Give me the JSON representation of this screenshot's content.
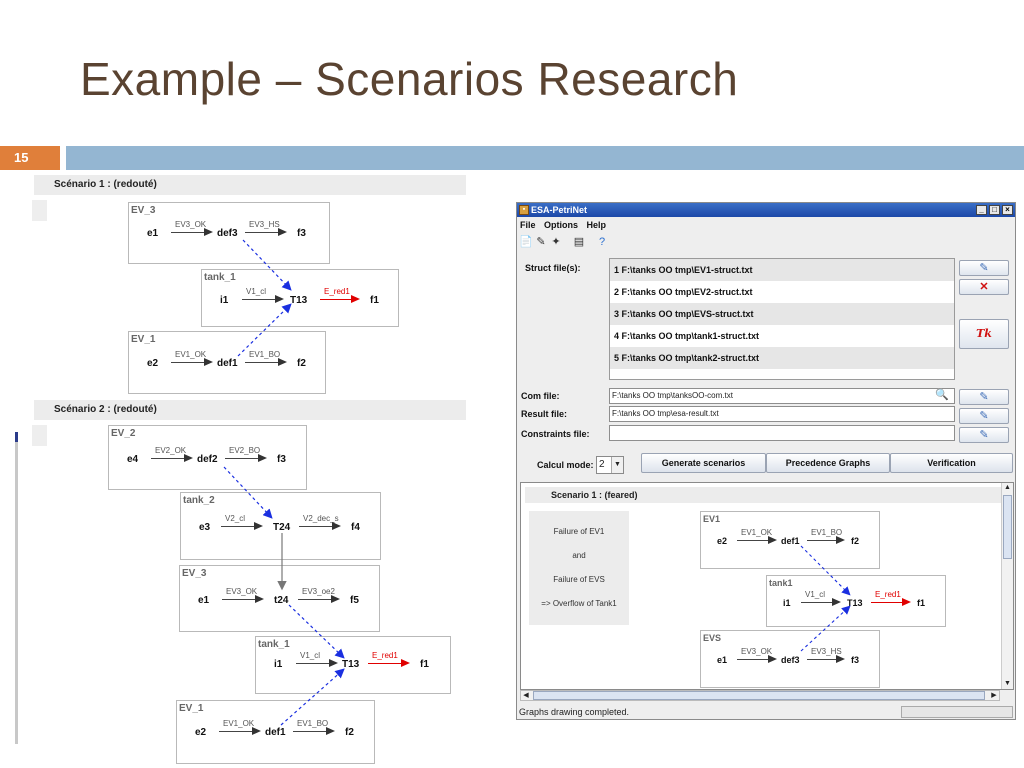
{
  "slide": {
    "title": "Example – Scenarios Research",
    "number": "15"
  },
  "scenario1": {
    "header": "Scénario 1 : (redouté)",
    "boxes": [
      {
        "label": "EV_3",
        "nodes": [
          "e1",
          "def3",
          "f3"
        ],
        "arrows": [
          "EV3_OK",
          "EV3_HS"
        ]
      },
      {
        "label": "tank_1",
        "nodes": [
          "i1",
          "T13",
          "f1"
        ],
        "arrows": [
          "V1_cl",
          "E_red1"
        ]
      },
      {
        "label": "EV_1",
        "nodes": [
          "e2",
          "def1",
          "f2"
        ],
        "arrows": [
          "EV1_OK",
          "EV1_BO"
        ]
      }
    ]
  },
  "scenario2": {
    "header": "Scénario 2 : (redouté)",
    "boxes": [
      {
        "label": "EV_2",
        "nodes": [
          "e4",
          "def2",
          "f3"
        ],
        "arrows": [
          "EV2_OK",
          "EV2_BO"
        ]
      },
      {
        "label": "tank_2",
        "nodes": [
          "e3",
          "T24",
          "f4"
        ],
        "arrows": [
          "V2_cl",
          "V2_dec_s"
        ]
      },
      {
        "label": "EV_3",
        "nodes": [
          "e1",
          "t24",
          "f5"
        ],
        "arrows": [
          "EV3_OK",
          "EV3_oe2"
        ]
      },
      {
        "label": "tank_1",
        "nodes": [
          "i1",
          "T13",
          "f1"
        ],
        "arrows": [
          "V1_cl",
          "E_red1"
        ]
      },
      {
        "label": "EV_1",
        "nodes": [
          "e2",
          "def1",
          "f2"
        ],
        "arrows": [
          "EV1_OK",
          "EV1_BO"
        ]
      }
    ]
  },
  "window": {
    "title": "ESA-PetriNet",
    "menu": [
      "File",
      "Options",
      "Help"
    ],
    "struct_label": "Struct file(s):",
    "struct_files": [
      "1  F:\\tanks OO tmp\\EV1-struct.txt",
      "2  F:\\tanks OO tmp\\EV2-struct.txt",
      "3  F:\\tanks OO tmp\\EVS-struct.txt",
      "4  F:\\tanks OO tmp\\tank1-struct.txt",
      "5  F:\\tanks OO tmp\\tank2-struct.txt"
    ],
    "com_label": "Com file:",
    "com_value": "F:\\tanks OO tmp\\tanksOO-com.txt",
    "result_label": "Result file:",
    "result_value": "F:\\tanks OO tmp\\esa-result.txt",
    "constraints_label": "Constraints file:",
    "constraints_value": "",
    "calcul_label": "Calcul mode:",
    "calcul_value": "2",
    "buttons": {
      "generate": "Generate scenarios",
      "precedence": "Precedence Graphs",
      "verification": "Verification"
    },
    "tk_button": "Tk",
    "scenario_header": "Scenario 1 : (feared)",
    "scenario_text": [
      "Failure of EV1",
      "and",
      "Failure of EVS",
      "=> Overflow of Tank1"
    ],
    "scenario_boxes": [
      {
        "label": "EV1",
        "nodes": [
          "e2",
          "def1",
          "f2"
        ],
        "arrows": [
          "EV1_OK",
          "EV1_BO"
        ]
      },
      {
        "label": "tank1",
        "nodes": [
          "i1",
          "T13",
          "f1"
        ],
        "arrows": [
          "V1_cl",
          "E_red1"
        ]
      },
      {
        "label": "EVS",
        "nodes": [
          "e1",
          "def3",
          "f3"
        ],
        "arrows": [
          "EV3_OK",
          "EV3_HS"
        ]
      }
    ],
    "status": "Graphs drawing completed."
  }
}
